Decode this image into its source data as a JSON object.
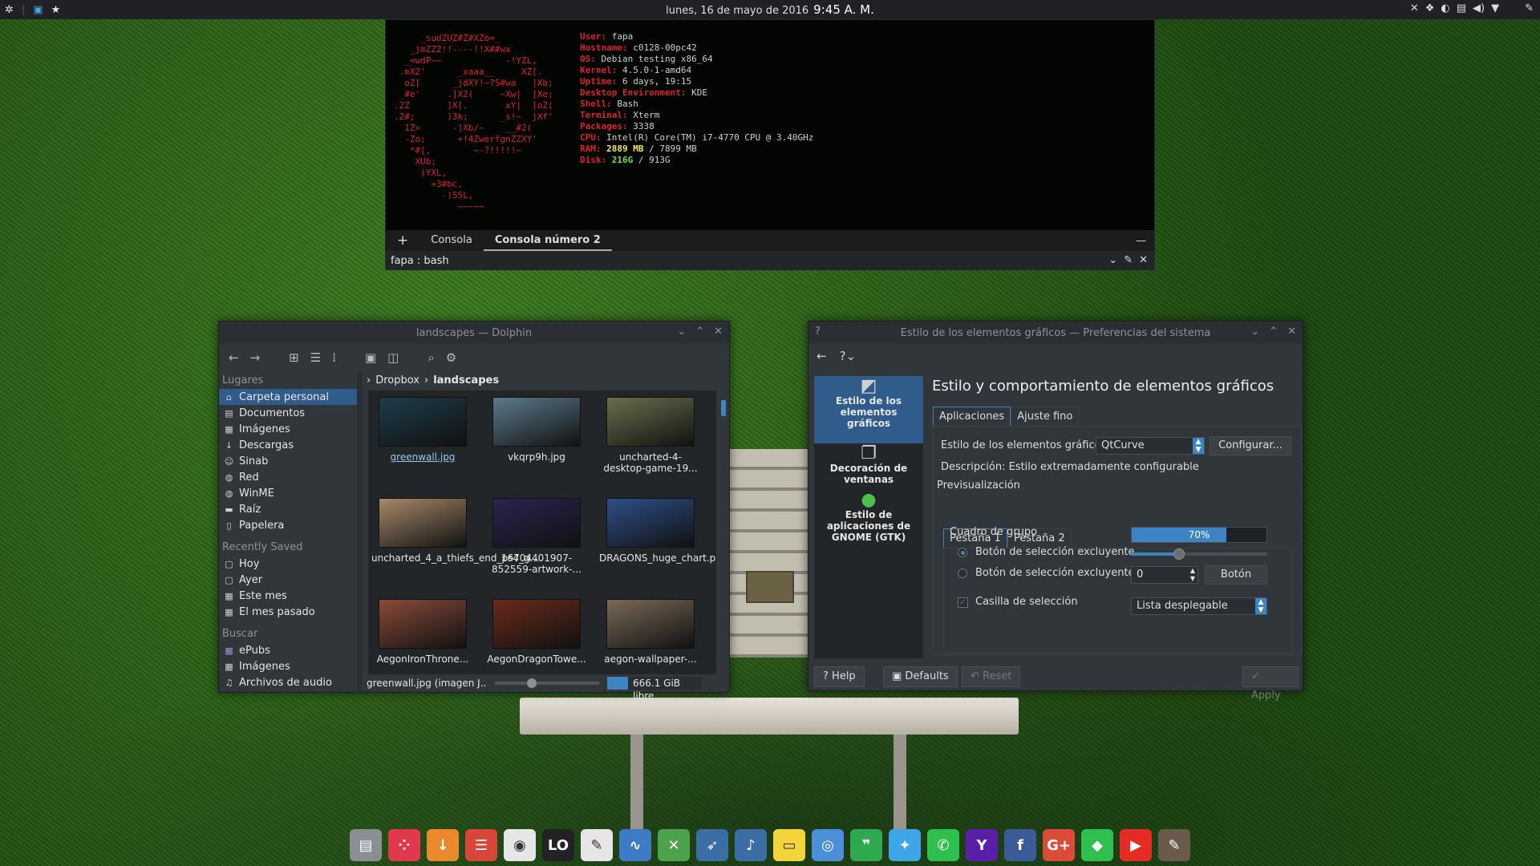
{
  "panel": {
    "date": "lunes, 16 de mayo de 2016",
    "time": "9:45 A. M."
  },
  "terminal": {
    "ascii": [
      "     _sudZUZ#Z#XZo=_",
      "   _jmZZ2!!----!!X##wx",
      "  _<wdP~~            -!YZL,",
      " .mX2'      _xaaa__     XZ[.",
      "  oZ[      _jdXY!~?S#wa   ]Xb;",
      " _#e'     .]X2(     ~Xw|  ]Xe;",
      ".2Z       ]X[.       xY|  ]oZ(",
      ".2#;      )3k;      _s!~  jXf'",
      "  1Z>      -]Xb/~    __#2(",
      "  -Zo;      +!4ZwerfgnZZXY'",
      "   *#[,        ~-?!!!!!~",
      "    XUb;",
      "     )YXL,",
      "       +3#bc,",
      "         -)SSL,",
      "            ~~~~~"
    ],
    "info": [
      {
        "k": "User:",
        "v": " fapa"
      },
      {
        "k": "Hostname:",
        "v": " c0128-00pc42"
      },
      {
        "k": "OS:",
        "v": " Debian testing x86_64"
      },
      {
        "k": "Kernel:",
        "v": " 4.5.0-1-amd64"
      },
      {
        "k": "Uptime:",
        "v": " 6 days, 19:15"
      },
      {
        "k": "Desktop Environment:",
        "v": " KDE"
      },
      {
        "k": "Shell:",
        "v": " Bash"
      },
      {
        "k": "Terminal:",
        "v": " Xterm"
      },
      {
        "k": "Packages:",
        "v": " 3338"
      },
      {
        "k": "CPU:",
        "v": " Intel(R) Core(TM) i7-4770 CPU @ 3.40GHz"
      }
    ],
    "ram": {
      "k": "RAM:",
      "used": " 2889 MB",
      "rest": " / 7899 MB"
    },
    "disk": {
      "k": "Disk:",
      "used": " 216G",
      "rest": " / 913G"
    },
    "tabs": [
      "Consola",
      "Consola número 2"
    ],
    "status": "fapa : bash"
  },
  "dolphin": {
    "title": "landscapes — Dolphin",
    "places_header": "Lugares",
    "places": [
      "Carpeta personal",
      "Documentos",
      "Imágenes",
      "Descargas",
      "Sinab",
      "Red",
      "WinME",
      "Raíz",
      "Papelera"
    ],
    "recent_header": "Recently Saved",
    "recent": [
      "Hoy",
      "Ayer",
      "Este mes",
      "El mes pasado"
    ],
    "search_header": "Buscar",
    "search": [
      "ePubs",
      "Imágenes",
      "Archivos de audio"
    ],
    "breadcrumb": [
      "Dropbox",
      "landscapes"
    ],
    "files": [
      {
        "name": "greenwall.jpg",
        "color": "#1e3c4a"
      },
      {
        "name": "vkqrp9h.jpg",
        "color": "#5c7a8c"
      },
      {
        "name": "uncharted-4-desktop-game-19...",
        "color": "#6a6f4e"
      },
      {
        "name": "uncharted_4_a_thiefs_end_ps4_g...",
        "color": "#a8896a"
      },
      {
        "name": "16704401907-852559-artwork-...",
        "color": "#2b2350"
      },
      {
        "name": "DRAGONS_huge_chart.png",
        "color": "#2e4f88"
      },
      {
        "name": "AegonIronThrone...",
        "color": "#8a4a3a"
      },
      {
        "name": "AegonDragonTowe...",
        "color": "#6a2a1a"
      },
      {
        "name": "aegon-wallpaper-...",
        "color": "#7a6a58"
      }
    ],
    "status_file": "greenwall.jpg (imagen J...",
    "free_space": "666.1 GiB libre",
    "free_fraction": 0.22
  },
  "settings": {
    "title": "Estilo de los elementos gráficos — Preferencias del sistema",
    "categories": [
      "Estilo de los elementos gráficos",
      "Decoración de ventanas",
      "Estilo de aplicaciones de GNOME (GTK)"
    ],
    "heading": "Estilo y comportamiento de elementos gráficos",
    "tabs": [
      "Aplicaciones",
      "Ajuste fino"
    ],
    "style_label": "Estilo de los elementos gráficos:",
    "style_value": "QtCurve",
    "configure": "Configurar...",
    "description": "Descripción: Estilo extremadamente configurable",
    "preview": "Previsualización",
    "preview_tabs": [
      "Pestaña 1",
      "Pestaña 2"
    ],
    "groupbox": "Cuadro de grupo",
    "progress": "70%",
    "progress_value": 0.7,
    "radio1": "Botón de selección excluyente",
    "radio2": "Botón de selección excluyente",
    "spin_value": "0",
    "button": "Botón",
    "checkbox": "Casilla de selección",
    "dropdown": "Lista desplegable",
    "slider_value": 0.35,
    "help": "Help",
    "defaults": "Defaults",
    "reset": "Reset",
    "apply": "Apply"
  },
  "dock": [
    {
      "icon": "folder-icon",
      "color": "#8a8f94",
      "glyph": "▤"
    },
    {
      "icon": "dice-app-icon",
      "color": "#e0394d",
      "glyph": "⁘"
    },
    {
      "icon": "download-icon",
      "color": "#e98a2c",
      "glyph": "↓"
    },
    {
      "icon": "list-app-icon",
      "color": "#d8463a",
      "glyph": "☰"
    },
    {
      "icon": "document-viewer-icon",
      "color": "#e6e6e6",
      "glyph": "◉"
    },
    {
      "icon": "libreoffice-icon",
      "color": "#222222",
      "glyph": "LO"
    },
    {
      "icon": "pdf-editor-icon",
      "color": "#e6e6e6",
      "glyph": "✎"
    },
    {
      "icon": "system-monitor-icon",
      "color": "#3d7bc4",
      "glyph": "∿"
    },
    {
      "icon": "spreadsheet-icon",
      "color": "#4ca34c",
      "glyph": "✕"
    },
    {
      "icon": "feather-icon",
      "color": "#3a6ea5",
      "glyph": "➶"
    },
    {
      "icon": "music-icon",
      "color": "#3a6ea5",
      "glyph": "♪"
    },
    {
      "icon": "notes-icon",
      "color": "#f3d43a",
      "glyph": "▭"
    },
    {
      "icon": "chrome-icon",
      "color": "#4a8fd8",
      "glyph": "◎"
    },
    {
      "icon": "hangouts-icon",
      "color": "#2fa84f",
      "glyph": "❞"
    },
    {
      "icon": "twitter-icon",
      "color": "#3ea6e8",
      "glyph": "✦"
    },
    {
      "icon": "whatsapp-icon",
      "color": "#2fbf4f",
      "glyph": "✆"
    },
    {
      "icon": "yahoo-icon",
      "color": "#5a1ea8",
      "glyph": "Y"
    },
    {
      "icon": "facebook-icon",
      "color": "#3b5b98",
      "glyph": "f"
    },
    {
      "icon": "google-plus-icon",
      "color": "#dc4a3a",
      "glyph": "G+"
    },
    {
      "icon": "feedly-icon",
      "color": "#2fbf4f",
      "glyph": "◆"
    },
    {
      "icon": "youtube-icon",
      "color": "#e62b24",
      "glyph": "▶"
    },
    {
      "icon": "kde-icon",
      "color": "#6a5a4a",
      "glyph": "✎"
    }
  ]
}
